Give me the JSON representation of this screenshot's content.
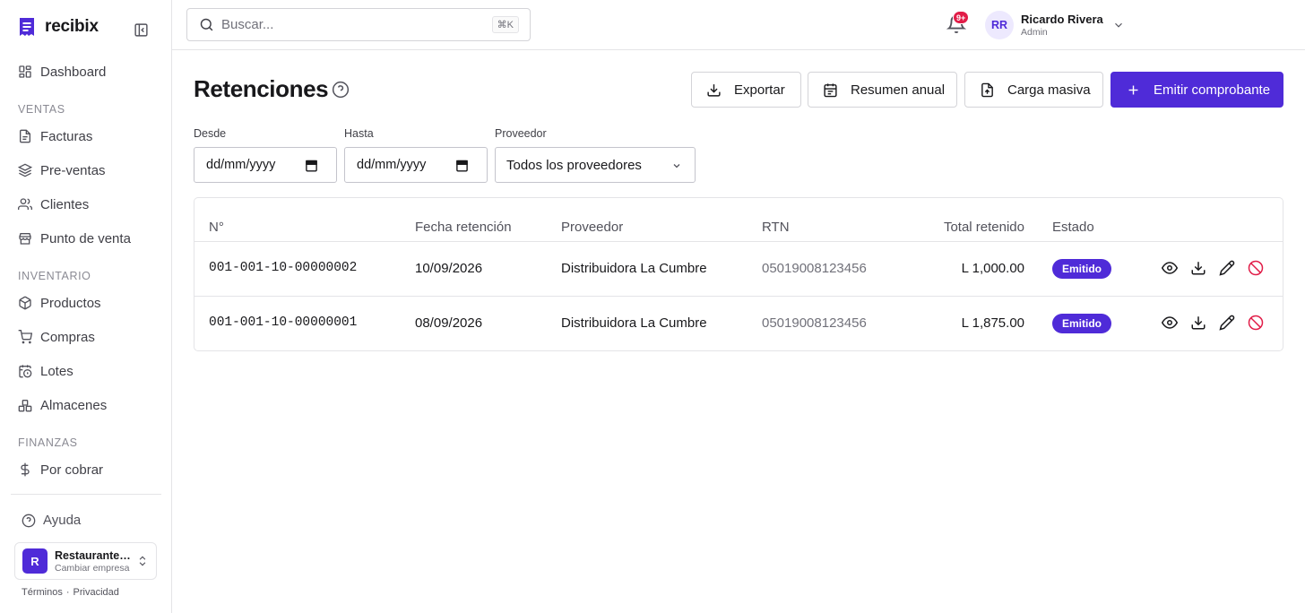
{
  "brand": {
    "name": "recibix"
  },
  "sidebar": {
    "dashboard": "Dashboard",
    "sections": {
      "ventas": "VENTAS",
      "inventario": "INVENTARIO",
      "finanzas": "FINANZAS"
    },
    "items": {
      "facturas": "Facturas",
      "preventas": "Pre-ventas",
      "clientes": "Clientes",
      "punto_venta": "Punto de venta",
      "productos": "Productos",
      "compras": "Compras",
      "lotes": "Lotes",
      "almacenes": "Almacenes",
      "por_cobrar": "Por cobrar"
    },
    "help": "Ayuda",
    "company": {
      "initial": "R",
      "name": "Restaurante La Cumbre",
      "sub": "Cambiar empresa"
    },
    "legal": {
      "terms": "Términos",
      "sep": "·",
      "privacy": "Privacidad"
    }
  },
  "topbar": {
    "search_placeholder": "Buscar...",
    "shortcut": "⌘K",
    "notifications_badge": "9+",
    "user": {
      "initials": "RR",
      "name": "Ricardo Rivera",
      "role": "Admin"
    }
  },
  "page": {
    "title": "Retenciones",
    "buttons": {
      "export": "Exportar",
      "annual": "Resumen anual",
      "bulk": "Carga masiva",
      "emit": "Emitir comprobante"
    },
    "filters": {
      "from_label": "Desde",
      "from_value": "dd/mm/yyyy",
      "to_label": "Hasta",
      "to_value": "dd/mm/yyyy",
      "provider_label": "Proveedor",
      "provider_value": "Todos los proveedores"
    }
  },
  "table": {
    "headers": {
      "number": "N°",
      "date": "Fecha retención",
      "provider": "Proveedor",
      "rtn": "RTN",
      "total": "Total retenido",
      "status": "Estado"
    },
    "rows": [
      {
        "number": "001-001-10-00000002",
        "date": "10/09/2026",
        "provider": "Distribuidora La Cumbre",
        "rtn": "05019008123456",
        "total": "L 1,000.00",
        "status": "Emitido"
      },
      {
        "number": "001-001-10-00000001",
        "date": "08/09/2026",
        "provider": "Distribuidora La Cumbre",
        "rtn": "05019008123456",
        "total": "L 1,875.00",
        "status": "Emitido"
      }
    ]
  },
  "colors": {
    "accent": "#4f2bd8",
    "badge_alert": "#e11d48",
    "cancel_icon": "#e11d48"
  },
  "icons": [
    "receipt-icon",
    "sidebar-toggle-icon",
    "grid-icon",
    "file-icon",
    "layers-icon",
    "users-icon",
    "store-icon",
    "box-icon",
    "cart-icon",
    "calendar-clock-icon",
    "warehouse-icon",
    "dollar-icon",
    "help-circle-icon",
    "chevrons-updown-icon",
    "search-icon",
    "bell-icon",
    "chevron-down-icon",
    "download-icon",
    "calendar-icon",
    "file-upload-icon",
    "plus-icon",
    "eye-icon",
    "pencil-icon",
    "ban-icon"
  ]
}
